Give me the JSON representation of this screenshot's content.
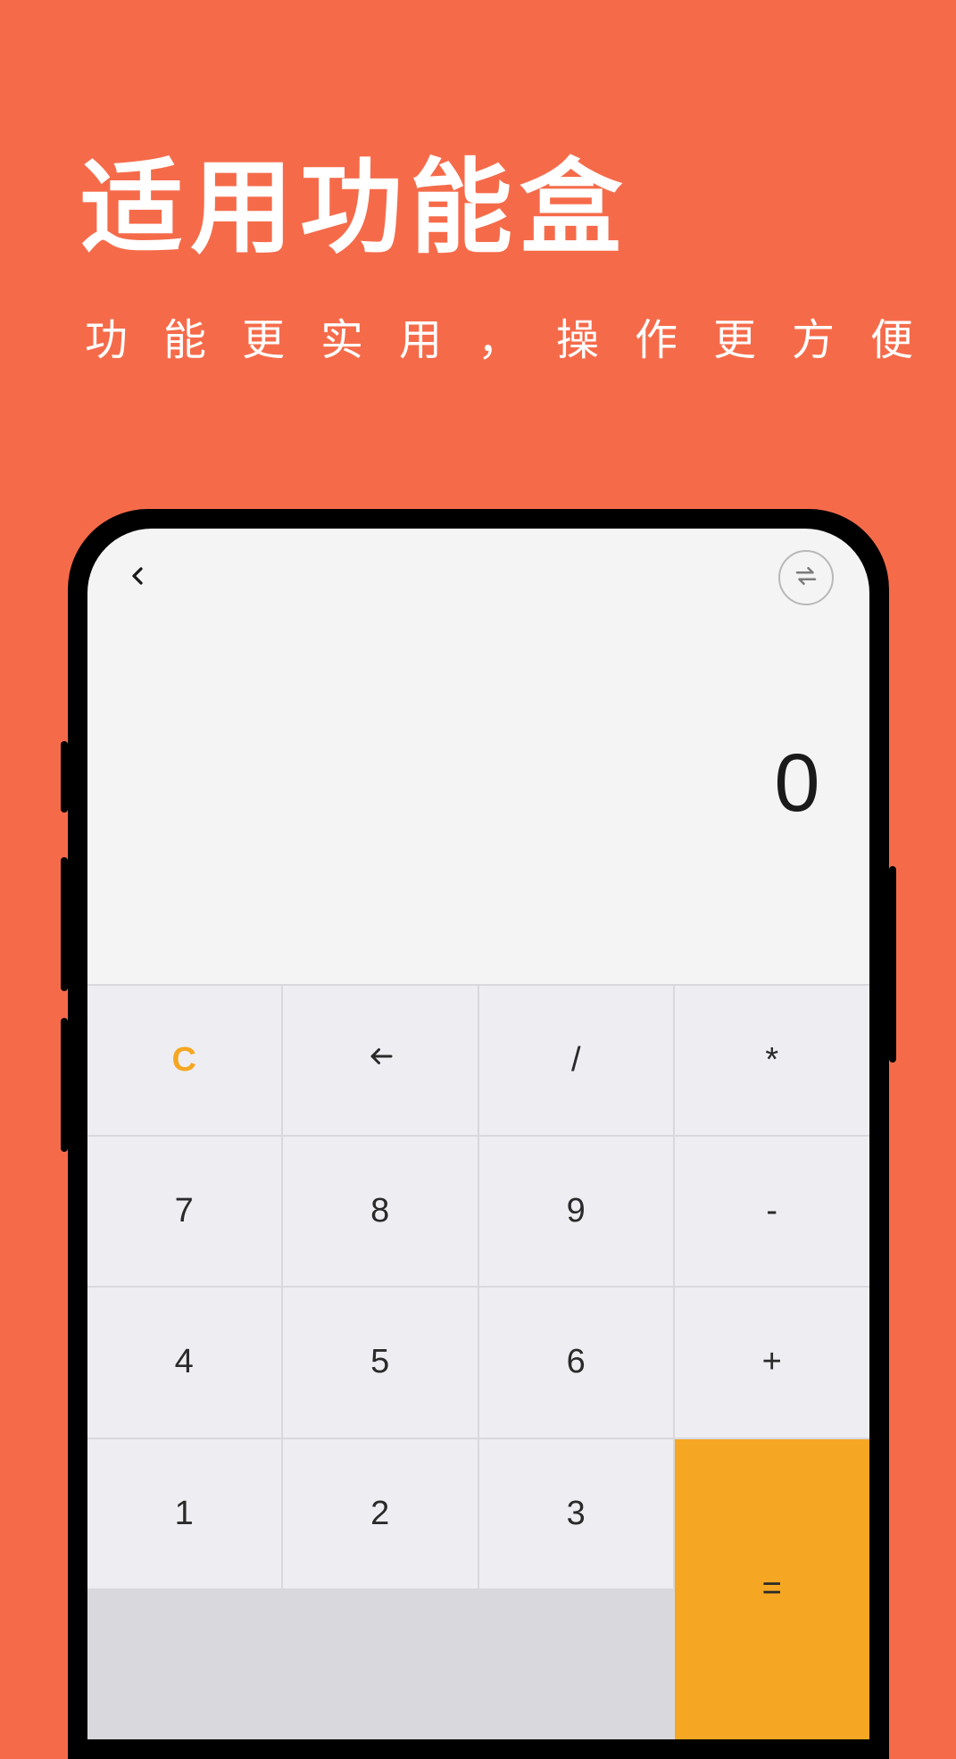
{
  "hero": {
    "title": "适用功能盒",
    "subtitle": "功能更实用，操作更方便"
  },
  "calculator": {
    "display": "0",
    "keys": {
      "clear": "C",
      "backspace": "←",
      "divide": "/",
      "multiply": "*",
      "k7": "7",
      "k8": "8",
      "k9": "9",
      "minus": "-",
      "k4": "4",
      "k5": "5",
      "k6": "6",
      "plus": "+",
      "k1": "1",
      "k2": "2",
      "k3": "3",
      "equals": "="
    }
  },
  "colors": {
    "background": "#f56b4a",
    "accent": "#f5a623",
    "key_bg": "#eeeef2",
    "display_bg": "#f4f4f4"
  }
}
